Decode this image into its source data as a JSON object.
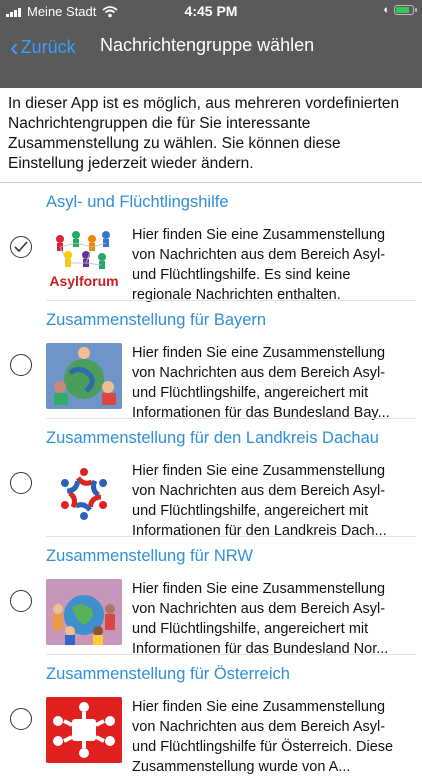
{
  "status_bar": {
    "carrier": "Meine Stadt",
    "time": "4:45 PM"
  },
  "nav": {
    "back_label": "Zurück",
    "title": "Nachrichtengruppe wählen"
  },
  "intro": "In dieser App ist es möglich, aus mehreren vordefinierten Nachrichtengruppen die für Sie interessante Zusammenstellung zu wählen. Sie können diese Einstellung jederzeit wieder ändern.",
  "groups": [
    {
      "title": "Asyl- und Flüchtlingshilfe",
      "selected": true,
      "thumb_label": "Asylforum",
      "description": "Hier finden Sie eine Zusammenstellung von Nachrichten aus dem Bereich Asyl- und Flüchtlingshilfe. Es sind keine regionale Nachrichten enthalten."
    },
    {
      "title": "Zusammenstellung für Bayern",
      "selected": false,
      "description": "Hier finden Sie eine Zusammenstellung von Nachrichten aus dem Bereich Asyl- und Flüchtlingshilfe, angereichert mit Informationen für das Bundesland Bay..."
    },
    {
      "title": "Zusammenstellung für den Landkreis Dachau",
      "selected": false,
      "description": "Hier finden Sie eine Zusammenstellung von Nachrichten aus dem Bereich Asyl- und Flüchtlingshilfe, angereichert mit Informationen für den Landkreis Dach..."
    },
    {
      "title": "Zusammenstellung für NRW",
      "selected": false,
      "description": "Hier finden Sie eine Zusammenstellung von Nachrichten aus dem Bereich Asyl- und Flüchtlingshilfe, angereichert mit Informationen für das Bundesland Nor..."
    },
    {
      "title": "Zusammenstellung für Österreich",
      "selected": false,
      "description": "Hier finden Sie eine Zusammenstellung von Nachrichten aus dem Bereich Asyl- und Flüchtlingshilfe für Österreich. Diese Zusammenstellung wurde von A..."
    }
  ],
  "colors": {
    "header": "#5a5a5a",
    "accent": "#3aa0ff",
    "title_link": "#2f8fd8"
  }
}
